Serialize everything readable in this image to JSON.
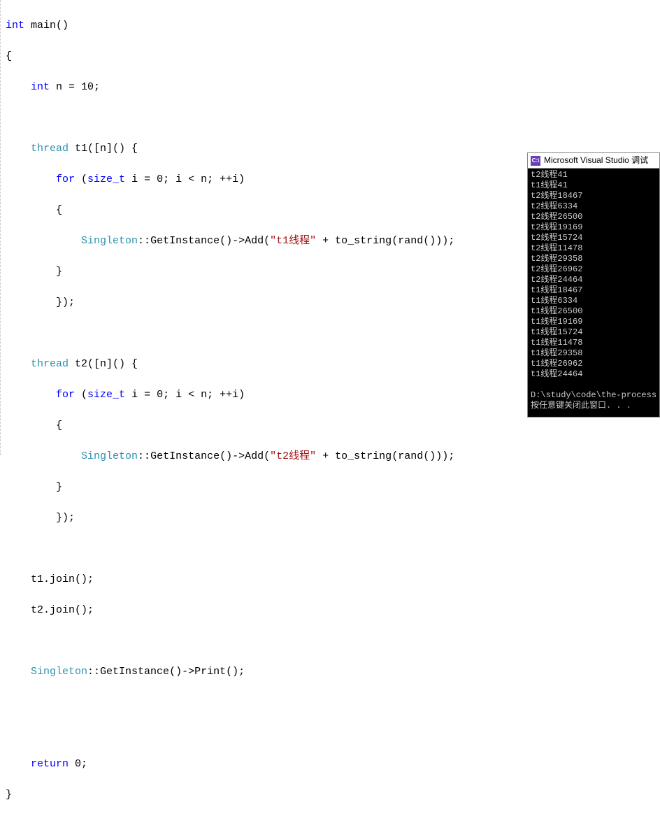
{
  "code": {
    "l1_int": "int",
    "l1_main": " main",
    "l1_paren": "()",
    "l2": "{",
    "l3_int": "int",
    "l3_rest": " n = 10;",
    "l5_thread": "thread",
    "l5_t1": " t1",
    "l5_rest": "([n]() {",
    "l6_for": "for",
    "l6_p1": " (",
    "l6_sizet": "size_t",
    "l6_rest": " i = 0; i < n; ++i)",
    "l7": "        {",
    "l8_pre": "            ",
    "l8_singleton": "Singleton",
    "l8_scope": "::",
    "l8_get": "GetInstance",
    "l8_mid": "()->",
    "l8_add": "Add",
    "l8_p1": "(",
    "l8_str": "\"t1线程\"",
    "l8_plus": " + ",
    "l8_tostr": "to_string",
    "l8_p2": "(",
    "l8_rand": "rand",
    "l8_end": "()));",
    "l9": "        }",
    "l10": "        });",
    "l12_thread": "thread",
    "l12_t2": " t2",
    "l12_rest": "([n]() {",
    "l13_for": "for",
    "l13_p1": " (",
    "l13_sizet": "size_t",
    "l13_rest": " i = 0; i < n; ++i)",
    "l14": "        {",
    "l15_pre": "            ",
    "l15_singleton": "Singleton",
    "l15_scope": "::",
    "l15_get": "GetInstance",
    "l15_mid": "()->",
    "l15_add": "Add",
    "l15_p1": "(",
    "l15_str": "\"t2线程\"",
    "l15_plus": " + ",
    "l15_tostr": "to_string",
    "l15_p2": "(",
    "l15_rand": "rand",
    "l15_end": "()));",
    "l16": "        }",
    "l17": "        });",
    "l19": "    t1.join();",
    "l20": "    t2.join();",
    "l22_pre": "    ",
    "l22_singleton": "Singleton",
    "l22_scope": "::",
    "l22_get": "GetInstance",
    "l22_mid": "()->",
    "l22_print": "Print",
    "l22_end": "();",
    "l25_return": "return",
    "l25_rest": " 0;",
    "l26": "}"
  },
  "console": {
    "title": "Microsoft Visual Studio 调试",
    "icon_text": "C:\\",
    "lines": [
      "t2线程41",
      "t1线程41",
      "t2线程18467",
      "t2线程6334",
      "t2线程26500",
      "t2线程19169",
      "t2线程15724",
      "t2线程11478",
      "t2线程29358",
      "t2线程26962",
      "t2线程24464",
      "t1线程18467",
      "t1线程6334",
      "t1线程26500",
      "t1线程19169",
      "t1线程15724",
      "t1线程11478",
      "t1线程29358",
      "t1线程26962",
      "t1线程24464"
    ],
    "path": "D:\\study\\code\\the-process",
    "prompt": "按任意键关闭此窗口. . ."
  }
}
